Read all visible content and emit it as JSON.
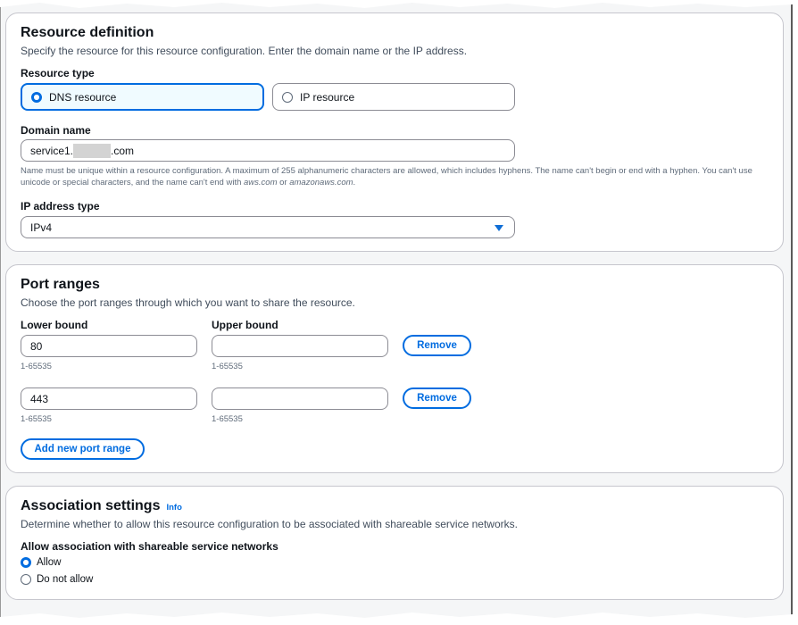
{
  "resource_definition": {
    "title": "Resource definition",
    "description": "Specify the resource for this resource configuration. Enter the domain name or the IP address.",
    "resource_type_label": "Resource type",
    "options": [
      {
        "label": "DNS resource",
        "selected": true
      },
      {
        "label": "IP resource",
        "selected": false
      }
    ],
    "domain_name_label": "Domain name",
    "domain_value_prefix": "service1.",
    "domain_value_suffix": ".com",
    "domain_hint_part1": "Name must be unique within a resource configuration. A maximum of 255 alphanumeric characters are allowed, which includes hyphens. The name can't begin or end with a hyphen. You can't use unicode or special characters, and the name can't end with ",
    "domain_hint_aws": "aws.com",
    "domain_hint_or": " or ",
    "domain_hint_amazonaws": "amazonaws.com",
    "domain_hint_end": ".",
    "ip_address_type_label": "IP address type",
    "ip_address_type_value": "IPv4"
  },
  "port_ranges": {
    "title": "Port ranges",
    "description": "Choose the port ranges through which you want to share the resource.",
    "lower_label": "Lower bound",
    "upper_label": "Upper bound",
    "rows": [
      {
        "lower": "80",
        "upper": "",
        "lower_hint": "1-65535",
        "upper_hint": "1-65535",
        "remove_label": "Remove"
      },
      {
        "lower": "443",
        "upper": "",
        "lower_hint": "1-65535",
        "upper_hint": "1-65535",
        "remove_label": "Remove"
      }
    ],
    "add_label": "Add new port range"
  },
  "association": {
    "title": "Association settings",
    "info_label": "Info",
    "description": "Determine whether to allow this resource configuration to be associated with shareable service networks.",
    "allow_label": "Allow association with shareable service networks",
    "options": [
      {
        "label": "Allow",
        "selected": true
      },
      {
        "label": "Do not allow",
        "selected": false
      }
    ]
  },
  "colors": {
    "accent": "#006ce0",
    "selected_tile_bg": "#f0fbff",
    "border": "#8c8c94"
  }
}
